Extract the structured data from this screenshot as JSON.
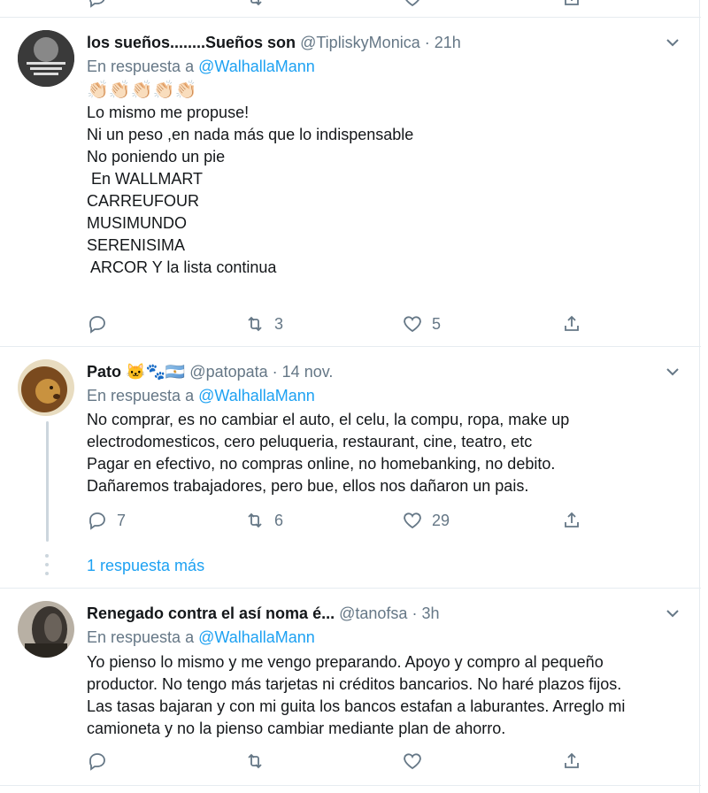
{
  "tweets": [
    {
      "name": "los sueños........Sueños son",
      "handle": "@TipliskyMonica",
      "sep": "·",
      "time": "21h",
      "reply_prefix": "En respuesta a",
      "reply_to": "@WalhallaMann",
      "emoji": "👏🏻👏🏻👏🏻👏🏻👏🏻",
      "lines": [
        "",
        "Lo mismo me propuse!",
        "Ni un peso ,en nada más que lo indispensable",
        "No poniendo un pie",
        " En WALLMART",
        "CARREUFOUR",
        "MUSIMUNDO",
        "SERENISIMA",
        " ARCOR Y la lista continua"
      ],
      "replies": "",
      "retweets": "3",
      "likes": "5"
    },
    {
      "name": "Pato",
      "name_emoji": "🐱🐾🇦🇷",
      "handle": "@patopata",
      "sep": "·",
      "time": "14 nov.",
      "reply_prefix": "En respuesta a",
      "reply_to": "@WalhallaMann",
      "lines": [
        "No comprar, es no cambiar el auto, el celu, la compu, ropa, make up",
        "electrodomesticos, cero peluqueria, restaurant, cine, teatro, etc",
        "Pagar en efectivo, no compras online, no homebanking, no debito.",
        "Dañaremos trabajadores, pero bue, ellos nos dañaron un pais."
      ],
      "replies": "7",
      "retweets": "6",
      "likes": "29",
      "more_replies": "1 respuesta más"
    },
    {
      "name": "Renegado contra el así noma é...",
      "handle": "@tanofsa",
      "sep": "·",
      "time": "3h",
      "reply_prefix": "En respuesta a",
      "reply_to": "@WalhallaMann",
      "lines": [
        "Yo pienso lo mismo y me vengo preparando. Apoyo y compro al pequeño",
        "productor. No tengo más tarjetas ni créditos bancarios. No haré plazos fijos.",
        "Las tasas bajaran y con mi guita los bancos estafan a laburantes. Arreglo mi",
        "camioneta y no la pienso cambiar mediante plan de ahorro."
      ],
      "replies": "",
      "retweets": "",
      "likes": ""
    }
  ],
  "colors": {
    "accent": "#1da1f2",
    "muted": "#657786",
    "text": "#14171a",
    "border": "#e6ecf0"
  },
  "icons": [
    "reply-icon",
    "retweet-icon",
    "like-icon",
    "share-icon",
    "chevron-down-icon"
  ]
}
